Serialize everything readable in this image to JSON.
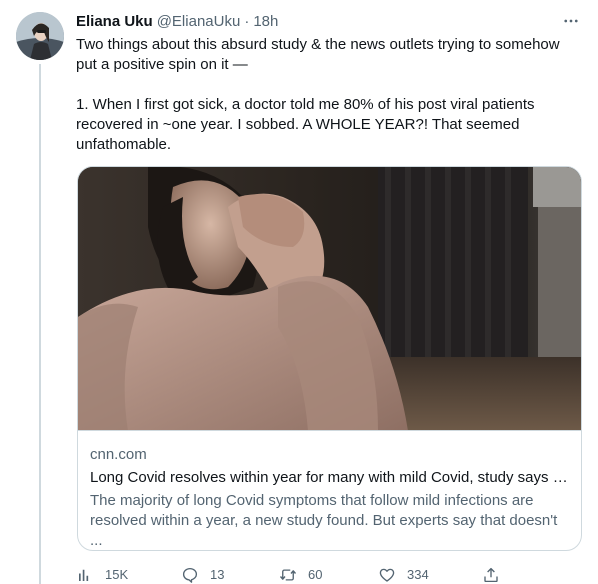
{
  "tweet": {
    "author_name": "Eliana Uku",
    "author_handle": "@ElianaUku",
    "separator": "·",
    "time": "18h",
    "text": "Two things about this absurd study & the news outlets trying to somehow put a positive spin on it —\n\n1. When I first got sick, a doctor told me 80% of his post viral patients recovered in ~one year. I sobbed. A WHOLE YEAR?! That seemed unfathomable."
  },
  "card": {
    "domain": "cnn.com",
    "title": "Long Covid resolves within year for many with mild Covid, study says | ...",
    "description": "The majority of long Covid symptoms that follow mild infections are resolved within a year, a new study found. But experts say that doesn't ..."
  },
  "actions": {
    "views": "15K",
    "replies": "13",
    "retweets": "60",
    "likes": "334"
  },
  "icons": {
    "more": "more-horizontal-icon",
    "views": "analytics-icon",
    "reply": "reply-icon",
    "retweet": "retweet-icon",
    "like": "heart-icon",
    "share": "share-icon"
  },
  "colors": {
    "secondary_text": "#536471",
    "border": "#cfd9de"
  }
}
